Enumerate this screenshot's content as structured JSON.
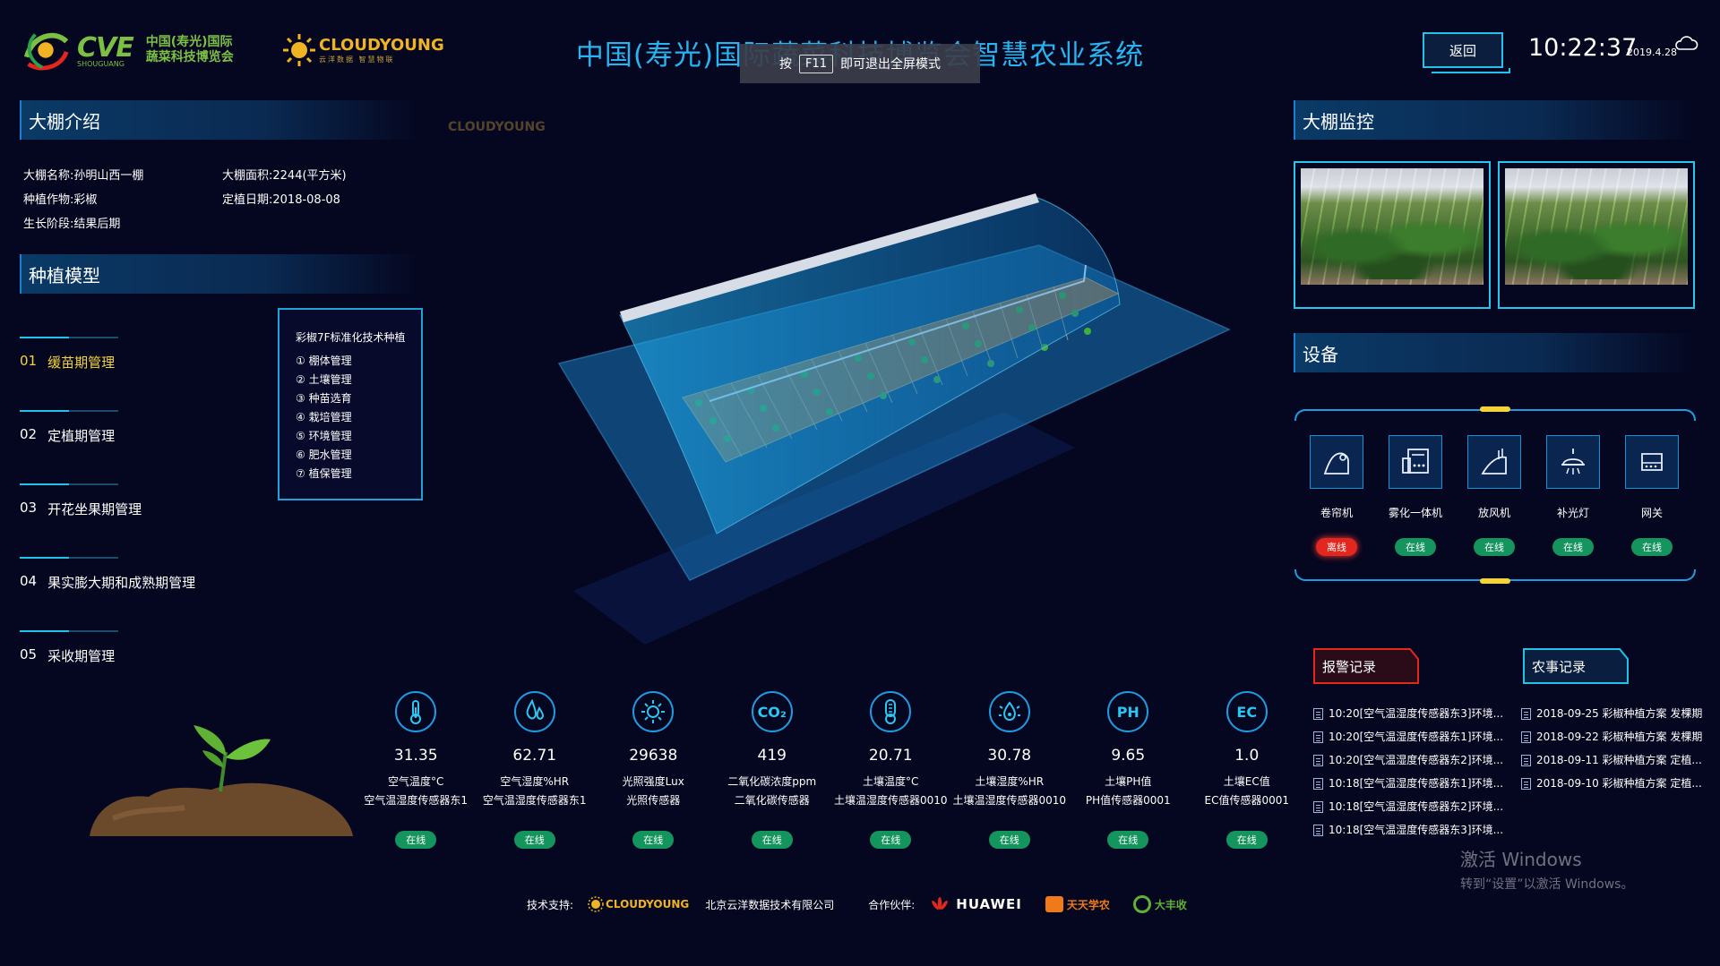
{
  "header": {
    "logo_cve_word": "CVE",
    "logo_cve_sub": "SHOUGUANG",
    "logo_cve_cn_1": "中国(寿光)国际",
    "logo_cve_cn_2": "蔬菜科技博览会",
    "logo_cy_word": "CLOUDYOUNG",
    "logo_cy_sub": "云洋数据 智慧物联",
    "title": "中国(寿光)国际蔬菜科技博览会智慧农业系统",
    "fullscreen_tip": {
      "prefix": "按",
      "key": "F11",
      "suffix": "即可退出全屏模式"
    },
    "back_label": "返回",
    "time": "10:22:37",
    "date": "2019.4.28",
    "weather_icon": "cloud-icon"
  },
  "intro": {
    "title": "大棚介绍",
    "fields": [
      {
        "label": "大棚名称:",
        "value": "孙明山西一棚"
      },
      {
        "label": "大棚面积:",
        "value": "2244(平方米)"
      },
      {
        "label": "种植作物:",
        "value": "彩椒"
      },
      {
        "label": "定植日期:",
        "value": "2018-08-08"
      },
      {
        "label": "生长阶段:",
        "value": "结果后期"
      }
    ]
  },
  "planting": {
    "title": "种植模型",
    "stages": [
      {
        "num": "01",
        "label": "缓苗期管理",
        "active": true
      },
      {
        "num": "02",
        "label": "定植期管理",
        "active": false
      },
      {
        "num": "03",
        "label": "开花坐果期管理",
        "active": false
      },
      {
        "num": "04",
        "label": "果实膨大期和成熟期管理",
        "active": false
      },
      {
        "num": "05",
        "label": "采收期管理",
        "active": false
      }
    ],
    "tech_title": "彩椒7F标准化技术种植",
    "tech_items": [
      "① 棚体管理",
      "② 土壤管理",
      "③ 种苗选育",
      "④ 栽培管理",
      "⑤ 环境管理",
      "⑥ 肥水管理",
      "⑦ 植保管理"
    ]
  },
  "center": {
    "watermark": "CLOUDYOUNG"
  },
  "sensors": [
    {
      "icon": "thermometer-icon",
      "glyph": "🌡",
      "value": "31.35",
      "name": "空气温度°C",
      "source": "空气温湿度传感器东1",
      "status": "在线"
    },
    {
      "icon": "humidity-icon",
      "glyph": "💧",
      "value": "62.71",
      "name": "空气湿度%HR",
      "source": "空气温湿度传感器东1",
      "status": "在线"
    },
    {
      "icon": "light-icon",
      "glyph": "☀",
      "value": "29638",
      "name": "光照强度Lux",
      "source": "光照传感器",
      "status": "在线"
    },
    {
      "icon": "co2-icon",
      "glyph": "CO₂",
      "value": "419",
      "name": "二氧化碳浓度ppm",
      "source": "二氧化碳传感器",
      "status": "在线"
    },
    {
      "icon": "soil-temp-icon",
      "glyph": "🌡",
      "value": "20.71",
      "name": "土壤温度°C",
      "source": "土壤温湿度传感器0010",
      "status": "在线"
    },
    {
      "icon": "soil-humidity-icon",
      "glyph": "💧",
      "value": "30.78",
      "name": "土壤湿度%HR",
      "source": "土壤温湿度传感器0010",
      "status": "在线"
    },
    {
      "icon": "ph-icon",
      "glyph": "PH",
      "value": "9.65",
      "name": "土壤PH值",
      "source": "PH值传感器0001",
      "status": "在线"
    },
    {
      "icon": "ec-icon",
      "glyph": "EC",
      "value": "1.0",
      "name": "土壤EC值",
      "source": "EC值传感器0001",
      "status": "在线"
    }
  ],
  "monitor": {
    "title": "大棚监控"
  },
  "devices": {
    "title": "设备",
    "items": [
      {
        "icon": "curtain-machine-icon",
        "name": "卷帘机",
        "status": "离线",
        "online": false
      },
      {
        "icon": "spray-unit-icon",
        "name": "雾化一体机",
        "status": "在线",
        "online": true
      },
      {
        "icon": "ventilation-icon",
        "name": "放风机",
        "status": "在线",
        "online": true
      },
      {
        "icon": "grow-light-icon",
        "name": "补光灯",
        "status": "在线",
        "online": true
      },
      {
        "icon": "gateway-icon",
        "name": "网关",
        "status": "在线",
        "online": true
      }
    ]
  },
  "records": {
    "alarm_tab": "报警记录",
    "farm_tab": "农事记录",
    "alarm_items": [
      "10:20[空气温湿度传感器东3]环境...",
      "10:20[空气温湿度传感器东1]环境...",
      "10:20[空气温湿度传感器东2]环境...",
      "10:18[空气温湿度传感器东1]环境...",
      "10:18[空气温湿度传感器东2]环境...",
      "10:18[空气温湿度传感器东3]环境..."
    ],
    "farm_items": [
      "2018-09-25 彩椒种植方案 发棵期",
      "2018-09-22 彩椒种植方案 发棵期",
      "2018-09-11 彩椒种植方案 定植...",
      "2018-09-10 彩椒种植方案 定植..."
    ]
  },
  "windows": {
    "line1": "激活 Windows",
    "line2": "转到“设置”以激活 Windows。"
  },
  "footer": {
    "tech_label": "技术支持:",
    "tech_logo": "CLOUDYOUNG",
    "tech_company": "北京云洋数据技术有限公司",
    "partner_label": "合作伙伴:",
    "partner_1": "HUAWEI",
    "partner_2": "天天学农",
    "partner_3": "大丰收"
  }
}
